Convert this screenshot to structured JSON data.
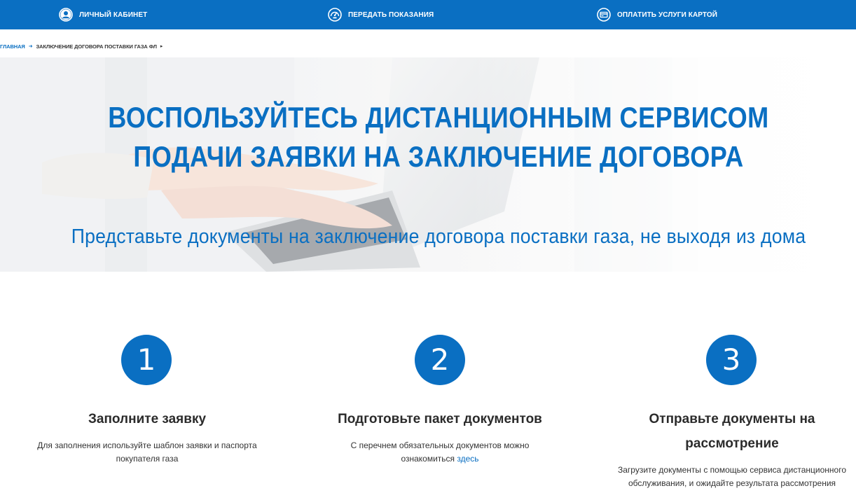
{
  "nav": {
    "items": [
      {
        "label": "Личный кабинет",
        "icon": "user-icon"
      },
      {
        "label": "Передать показания",
        "icon": "gauge-icon"
      },
      {
        "label": "Оплатить услуги картой",
        "icon": "card-icon"
      }
    ]
  },
  "breadcrumb": {
    "home": "Главная",
    "current": "Заключение договора поставки газа ФЛ"
  },
  "hero": {
    "title_line1": "Воспользуйтесь дистанционным сервисом",
    "title_line2": "подачи заявки на заключение договора",
    "subtitle": "Представьте документы на заключение договора поставки газа, не выходя из дома"
  },
  "steps": [
    {
      "number": "1",
      "title": "Заполните заявку",
      "desc_line1": "Для заполнения используйте шаблон заявки и паспорта",
      "desc_line2": "покупателя газа"
    },
    {
      "number": "2",
      "title": "Подготовьте пакет документов",
      "desc_line1": "С перечнем обязательных документов можно",
      "desc_line2": "ознакомиться",
      "link": "здесь"
    },
    {
      "number": "3",
      "title_line1": "Отправьте документы на",
      "title_line2": "рассмотрение",
      "desc_line1": "Загрузите документы с помощью сервиса дистанционного",
      "desc_line2": "обслуживания, и ожидайте результата рассмотрения"
    }
  ],
  "colors": {
    "brand_blue": "#0a6fc2",
    "text_dark": "#2b2b2b"
  }
}
